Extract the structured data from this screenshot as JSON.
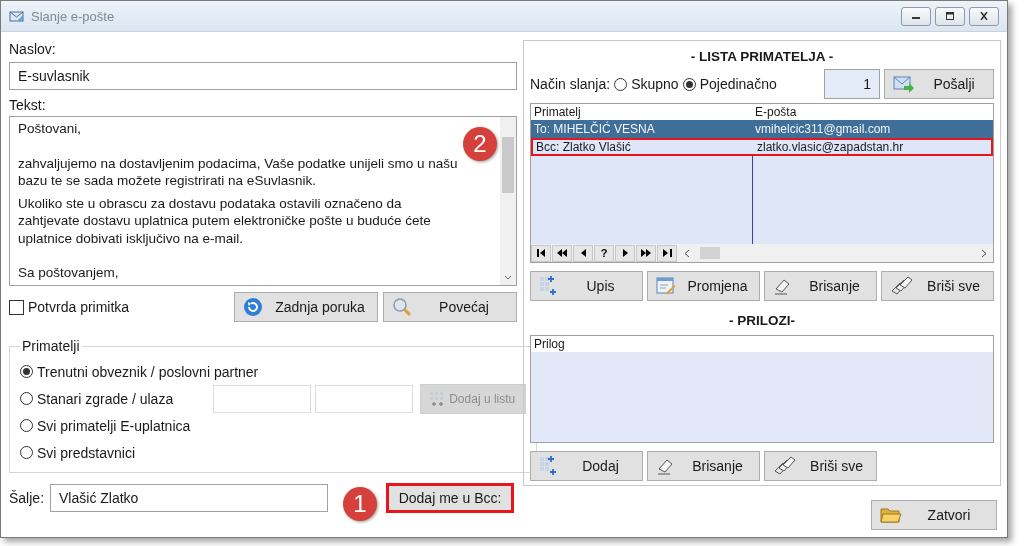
{
  "window": {
    "title": "Slanje e-pošte"
  },
  "subject": {
    "label": "Naslov:",
    "value": "E-suvlasnik"
  },
  "message": {
    "label": "Tekst:",
    "paragraphs": [
      {
        "text": "Poštovani,",
        "blank_before": false
      },
      {
        "text": "zahvaljujemo na dostavljenim podacima, Vaše podatke unijeli smo u našu bazu te se sada možete registrirati na eSuvlasnik.",
        "blank_before": true
      },
      {
        "text": "Ukoliko ste u obrascu za dostavu podataka ostavili označeno da zahtjevate dostavu uplatnica putem elektroničke pošte u buduće ćete uplatnice dobivati isključivo na e-mail.",
        "blank_before": false
      },
      {
        "text": "Sa poštovanjem,",
        "blank_before": true
      }
    ]
  },
  "read_receipt": {
    "label": "Potvrda primitka",
    "checked": false
  },
  "message_buttons": [
    {
      "label": "Zadnja poruka",
      "kind": "refresh"
    },
    {
      "label": "Povećaj",
      "kind": "magnifier"
    }
  ],
  "recipients_group": {
    "title": "Primatelji",
    "options": [
      {
        "label": "Trenutni obveznik / poslovni partner",
        "selected": true,
        "kind": "plain"
      },
      {
        "label": "Stanari zgrade / ulaza",
        "selected": false,
        "kind": "building"
      },
      {
        "label": "Svi primatelji E-uplatnica",
        "selected": false,
        "kind": "plain"
      },
      {
        "label": "Svi predstavnici",
        "selected": false,
        "kind": "plain"
      }
    ],
    "add_button": {
      "label": "Dodaj u listu",
      "disabled": true
    }
  },
  "sender": {
    "label": "Šalje:",
    "value": "Vlašić Zlatko",
    "bcc_button": {
      "label": "Dodaj me u Bcc:",
      "highlighted": true
    }
  },
  "recipient_list": {
    "title": "- LISTA PRIMATELJA -",
    "mode_label": "Način slanja:",
    "modes": [
      {
        "label": "Skupno",
        "selected": false
      },
      {
        "label": "Pojedinačno",
        "selected": true
      }
    ],
    "count": "1",
    "send_button": "Pošalji",
    "columns": [
      "Primatelj",
      "E-pošta"
    ],
    "rows": [
      {
        "recipient": "To:  MIHELČIĆ VESNA",
        "email": "vmihelcic311@gmail.com",
        "selected": true,
        "highlighted": false
      },
      {
        "recipient": "Bcc: Zlatko Vlašić",
        "email": "zlatko.vlasic@zapadstan.hr",
        "selected": false,
        "highlighted": true
      }
    ],
    "navigator": [
      {
        "kind": "first"
      },
      {
        "kind": "prev_page"
      },
      {
        "kind": "prev"
      },
      {
        "kind": "text",
        "label": "?"
      },
      {
        "kind": "next"
      },
      {
        "kind": "next_page"
      },
      {
        "kind": "last"
      }
    ],
    "buttons": [
      {
        "label": "Upis",
        "kind": "add"
      },
      {
        "label": "Promjena",
        "kind": "edit"
      },
      {
        "label": "Brisanje",
        "kind": "erase"
      },
      {
        "label": "Briši sve",
        "kind": "erase_all"
      }
    ]
  },
  "attachments": {
    "title": "- PRILOZI-",
    "columns": [
      "Prilog"
    ],
    "buttons": [
      {
        "label": "Dodaj",
        "kind": "add"
      },
      {
        "label": "Brisanje",
        "kind": "erase"
      },
      {
        "label": "Briši sve",
        "kind": "erase_all"
      }
    ]
  },
  "close_button": {
    "label": "Zatvori",
    "kind": "folder"
  },
  "callouts": [
    {
      "number": "1"
    },
    {
      "number": "2"
    }
  ]
}
